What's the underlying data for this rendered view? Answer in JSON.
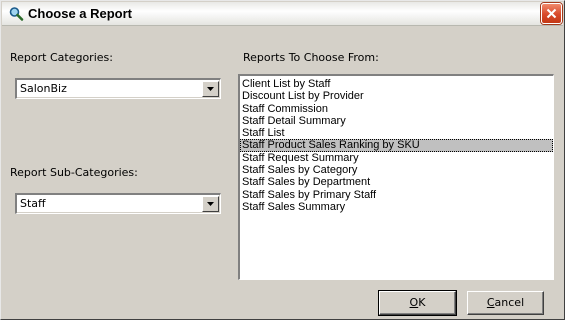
{
  "window": {
    "title": "Choose a Report",
    "title_icon": "magnifier-icon",
    "close_icon": "close-icon"
  },
  "categories": {
    "label": "Report Categories:",
    "selected": "SalonBiz"
  },
  "sub_categories": {
    "label": "Report Sub-Categories:",
    "selected": "Staff"
  },
  "reports": {
    "label": "Reports To Choose From:",
    "items": [
      "Client List by Staff",
      "Discount List by Provider",
      "Staff Commission",
      "Staff Detail Summary",
      "Staff List",
      "Staff Product Sales Ranking by SKU",
      "Staff Request Summary",
      "Staff Sales by Category",
      "Staff Sales by Department",
      "Staff Sales by Primary Staff",
      "Staff Sales Summary"
    ],
    "selected_index": 5
  },
  "buttons": {
    "ok_mnemonic": "O",
    "ok_rest": "K",
    "cancel_mnemonic": "C",
    "cancel_rest": "ancel"
  },
  "colors": {
    "dialog_bg": "#d4d0c8",
    "selection_bg": "#c0c0c0",
    "close_button": "#d8492a"
  }
}
